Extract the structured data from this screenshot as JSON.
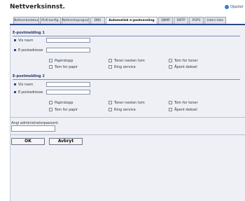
{
  "header": {
    "title": "Nettverksinnst.",
    "refresh_label": "Oppdat"
  },
  "tabs": [
    {
      "label": "Nettverksstatus"
    },
    {
      "label": "IPv6-konfig."
    },
    {
      "label": "Nettverksprogram"
    },
    {
      "label": "DNS"
    },
    {
      "label": "Automatisk e-postvarsling",
      "active": true
    },
    {
      "label": "SNMP"
    },
    {
      "label": "SMTP"
    },
    {
      "label": "POP3"
    },
    {
      "label": "Intern faks"
    }
  ],
  "sections": [
    {
      "title": "E-postmelding 1",
      "display_name_label": "Vis navn",
      "display_name_value": "",
      "email_label": "E-postadresse",
      "email_value": "",
      "checks": [
        {
          "label": "Papirstopp",
          "checked": false
        },
        {
          "label": "Toner nesten tom",
          "checked": false
        },
        {
          "label": "Tom for toner",
          "checked": false
        },
        {
          "label": "Tom for papir",
          "checked": false
        },
        {
          "label": "Ring service",
          "checked": false
        },
        {
          "label": "Åpent deksel",
          "checked": false
        }
      ]
    },
    {
      "title": "E-postmelding 2",
      "display_name_label": "Vis navn",
      "display_name_value": "",
      "email_label": "E-postadresse",
      "email_value": "",
      "checks": [
        {
          "label": "Papirstopp",
          "checked": false
        },
        {
          "label": "Toner nesten tom",
          "checked": false
        },
        {
          "label": "Tom for toner",
          "checked": false
        },
        {
          "label": "Tom for papir",
          "checked": false
        },
        {
          "label": "Ring service",
          "checked": false
        },
        {
          "label": "Åpent deksel",
          "checked": false
        }
      ]
    }
  ],
  "admin": {
    "label": "Angi administratorpassord.",
    "value": ""
  },
  "buttons": {
    "ok": "OK",
    "cancel": "Avbryt"
  },
  "colors": {
    "accent": "#2b4a8c",
    "panel": "#eef0f6"
  }
}
